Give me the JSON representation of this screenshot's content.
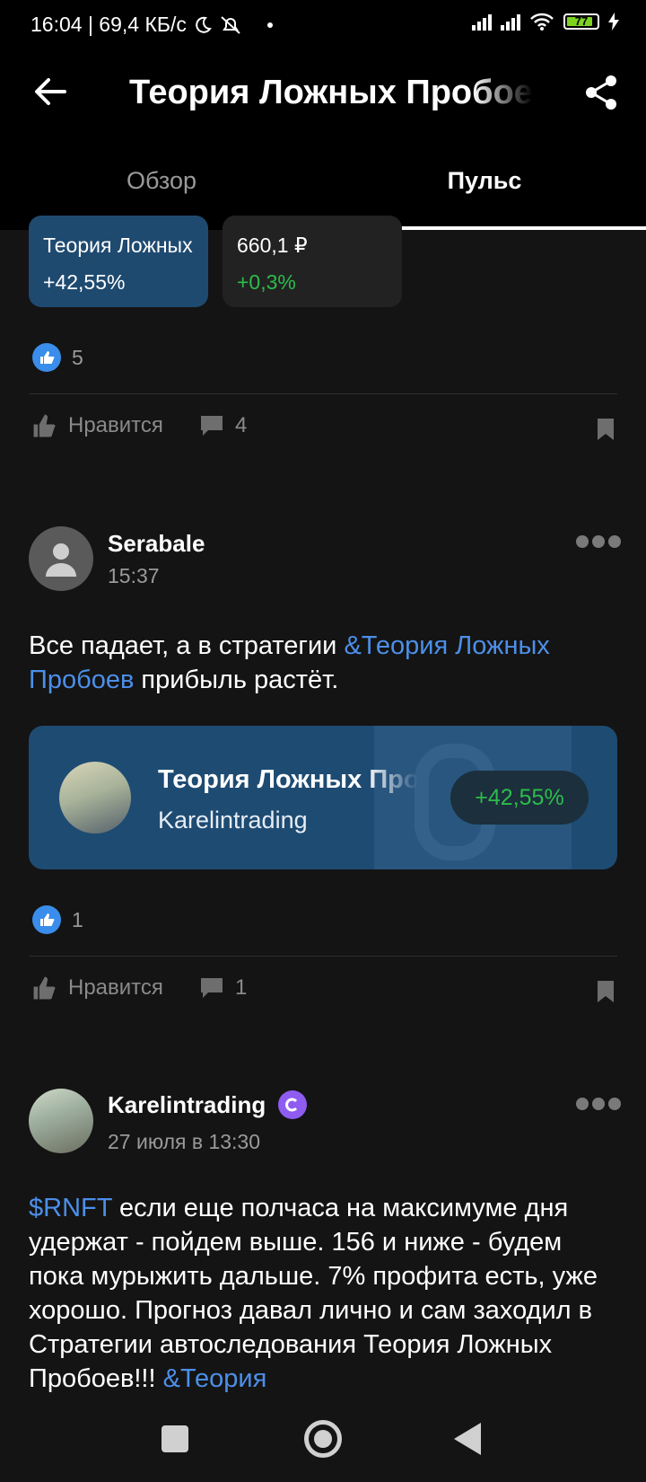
{
  "status_bar": {
    "time_speed": "16:04 | 69,4 КБ/с",
    "battery": "77"
  },
  "header": {
    "title": "Теория Ложных Пробоев",
    "tabs": [
      {
        "label": "Обзор",
        "active": false
      },
      {
        "label": "Пульс",
        "active": true
      }
    ]
  },
  "top_cards": [
    {
      "name": "Теория Ложных Пробоев",
      "change": "+42,55%"
    },
    {
      "name": "660,1 ₽",
      "change": "+0,3%"
    }
  ],
  "posts": [
    {
      "likes_count": "5",
      "like_label": "Нравится",
      "comments_count": "4"
    },
    {
      "author": "Serabale",
      "time": "15:37",
      "text_before": "Все падает, а в стратегии ",
      "link": "&Теория Ложных Пробоев",
      "text_after": " прибыль растёт.",
      "strategy": {
        "title": "Теория Ложных Пробоев",
        "author": "Karelintrading",
        "change": "+42,55%"
      },
      "likes_count": "1",
      "like_label": "Нравится",
      "comments_count": "1"
    },
    {
      "author": "Karelintrading",
      "time": "27 июля в 13:30",
      "ticker": "$RNFT",
      "text": " если еще полчаса на максимуме дня удержат - пойдем выше. 156 и ниже - будем пока мурыжить дальше. 7% профита есть, уже хорошо. Прогноз давал лично и сам заходил в Стратегии автоследования Теория Ложных Пробоев!!! ",
      "link_end": "&Теория"
    }
  ],
  "colors": {
    "accent_link": "#4c8fe8",
    "positive": "#2bbd4b",
    "card_blue": "#1e4b72",
    "like_blue": "#3a8dea",
    "verified_purple": "#8e5cf0"
  }
}
